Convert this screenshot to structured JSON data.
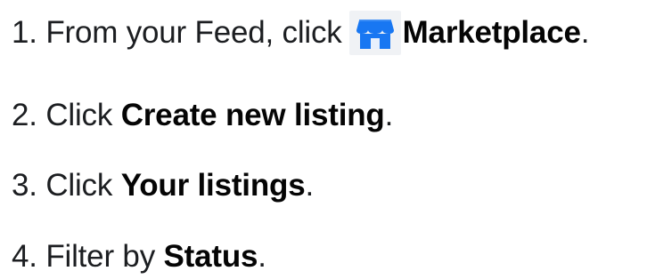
{
  "steps": [
    {
      "number": "1.",
      "before": "From your Feed, click",
      "icon": "marketplace-shop-icon",
      "bold": "Marketplace",
      "after": "."
    },
    {
      "number": "2.",
      "before": "Click",
      "bold": "Create new listing",
      "after": "."
    },
    {
      "number": "3.",
      "before": "Click",
      "bold": "Your listings",
      "after": "."
    },
    {
      "number": "4.",
      "before": "Filter by",
      "bold": "Status",
      "after": "."
    }
  ],
  "colors": {
    "text": "#1c1e21",
    "icon_blue": "#1877f2",
    "icon_bg": "#f0f2f5"
  }
}
